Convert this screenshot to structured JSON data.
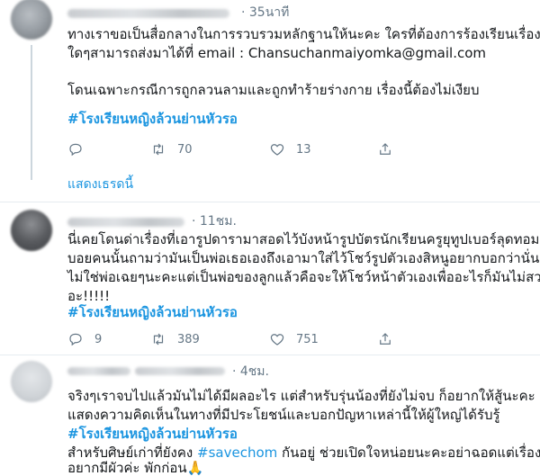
{
  "tweets": [
    {
      "time": "· 35นาที",
      "lines": [
        "ทางเราขอเป็นสื่อกลางในการรวบรวมหลักฐานให้นะคะ ใครที่ต้องการร้องเรียนเรื่อง",
        "ใดๆสามารถส่งมาได้ที่ email : Chansuchanmaiyomka@gmail.com",
        "โดนเฉพาะกรณีการถูกลวนลามและถูกทำร้ายร่างกาย เรื่องนี้ต้องไม่เงียบ"
      ],
      "hashtag": "#โรงเรียนหญิงล้วนย่านหัวรอ",
      "retweets": "70",
      "likes": "13",
      "show_thread": "แสดงเธรดนี้"
    },
    {
      "time": "· 11ชม.",
      "lines": [
        "นี่เคยโดนด่าเรื่องที่เอารูปดารามาสอดไว้บังหน้ารูปบัตรนักเรียนครูยุทูปเบอร์ลุดทอม",
        "บอยคนนั้นถามว่ามันเป็นพ่อเธอเองถึงเอามาใส่ไว้โชว์รูปตัวเองสิหนูอยากบอกว่านั่น",
        "ไม่ใช่พ่อเฉยๆนะคะแต่เป็นพ่อของลูกแล้วคือจะให้โชว์หน้าตัวเองเพื่ออะไรก็มันไม่สวย",
        "อะ!!!!!"
      ],
      "hashtag": "#โรงเรียนหญิงล้วนย่านหัวรอ",
      "replies": "9",
      "retweets": "389",
      "likes": "751"
    },
    {
      "time": "· 4ชม.",
      "lines": [
        "จริงๆเราจบไปแล้วมันไม่ได้มีผลอะไร แต่สำหรับรุ่นน้องที่ยังไม่จบ ก็อยากให้สู้นะคะ",
        "แสดงความคิดเห็นในทางที่มีประโยชน์และบอกปัญหาเหล่านี้ให้ผู้ใหญ่ได้รับรู้"
      ],
      "hashtag": "#โรงเรียนหญิงล้วนย่านหัวรอ",
      "line4_prefix": "สำหรับศิษย์เก่าที่ยังคง ",
      "line4_tag": "#savechom",
      "line4_suffix": " กันอยู่ ช่วยเปิดใจหน่อยนะคะอย่าฉอดแต่เรื่อง",
      "line5": "อยากมีผัวค่ะ พักก่อน",
      "line5_emoji": "🙏"
    }
  ],
  "colors": {
    "text": "#14171a",
    "secondary": "#657786",
    "link": "#1b95e0",
    "divider": "#e6ecf0"
  },
  "icons": {
    "reply": "reply-icon",
    "retweet": "retweet-icon",
    "like": "heart-icon"
  }
}
